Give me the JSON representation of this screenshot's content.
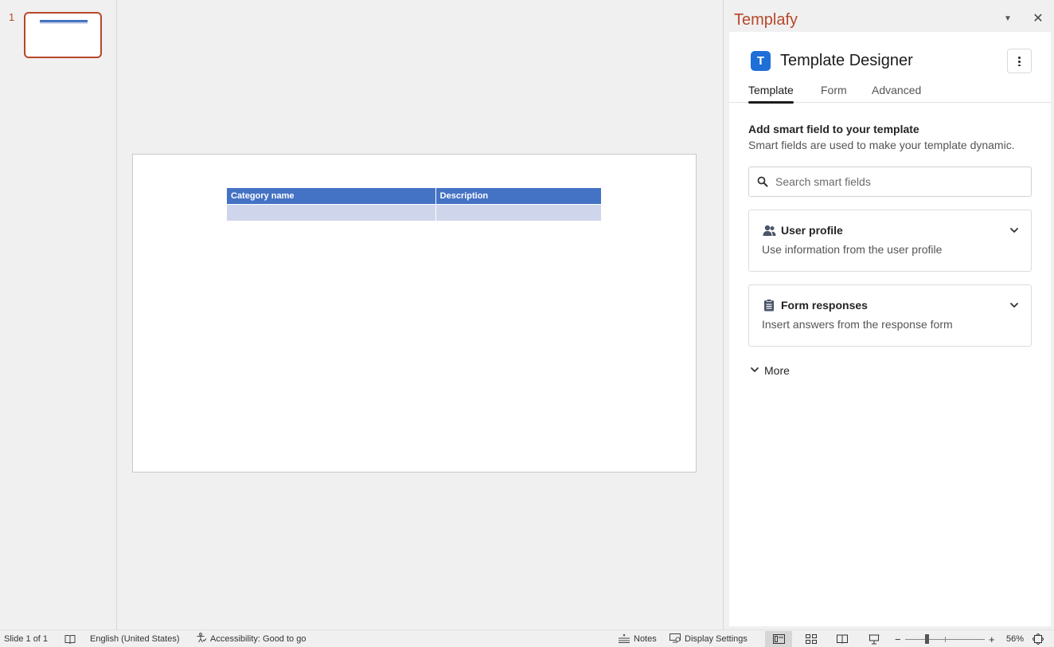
{
  "thumbnails": {
    "slide_number": "1"
  },
  "slide": {
    "table_headers": [
      "Category name",
      "Description"
    ]
  },
  "pane": {
    "title": "Templafy",
    "close_glyph": "✕",
    "dropdown_glyph": "▼"
  },
  "addin": {
    "logo_letter": "T",
    "title": "Template Designer",
    "tabs": [
      {
        "label": "Template",
        "active": true
      },
      {
        "label": "Form",
        "active": false
      },
      {
        "label": "Advanced",
        "active": false
      }
    ],
    "section_title": "Add smart field to your template",
    "section_subtitle": "Smart fields are used to make your template dynamic.",
    "search": {
      "placeholder": "Search smart fields",
      "value": ""
    },
    "cards": [
      {
        "title": "User profile",
        "subtitle": "Use information from the user profile",
        "icon": "people-icon"
      },
      {
        "title": "Form responses",
        "subtitle": "Insert answers from the response form",
        "icon": "clipboard-icon"
      }
    ],
    "more_label": "More"
  },
  "statusbar": {
    "slide_info": "Slide 1 of 1",
    "language": "English (United States)",
    "accessibility": "Accessibility: Good to go",
    "notes": "Notes",
    "display_settings": "Display Settings",
    "zoom_minus": "−",
    "zoom_plus": "+",
    "zoom_percent": "56%"
  },
  "colors": {
    "accent": "#b7472a",
    "table_header": "#4472c4",
    "table_row": "#cfd5ea",
    "logo": "#1f6fd8"
  }
}
